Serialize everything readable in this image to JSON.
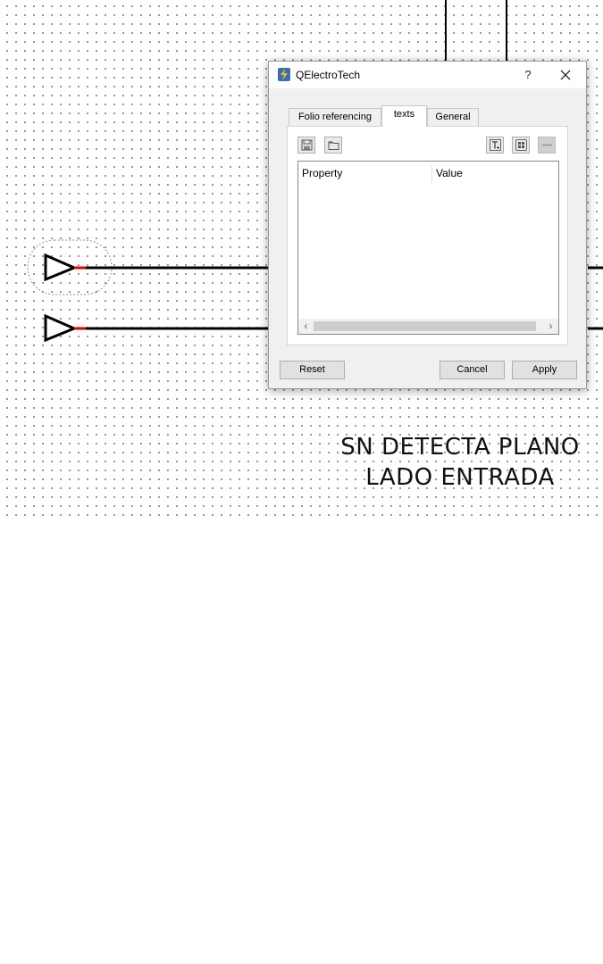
{
  "dialog": {
    "title": "QElectroTech",
    "help_label": "?",
    "tabs": [
      {
        "label": "Folio referencing",
        "active": false
      },
      {
        "label": "texts",
        "active": true
      },
      {
        "label": "General",
        "active": false
      }
    ],
    "toolbar_icons": [
      "save-icon",
      "open-folder-icon",
      "text-field-icon",
      "grid-group-icon",
      "remove-icon"
    ],
    "table": {
      "columns": [
        "Property",
        "Value"
      ],
      "rows": []
    },
    "scroll_left": "‹",
    "scroll_right": "›",
    "buttons": {
      "reset": "Reset",
      "cancel": "Cancel",
      "apply": "Apply"
    }
  },
  "diagram": {
    "text_lines": [
      "SN DETECTA PLANO",
      "LADO ENTRADA"
    ],
    "wire_color": "#000000",
    "terminal_color": "#e00000"
  }
}
